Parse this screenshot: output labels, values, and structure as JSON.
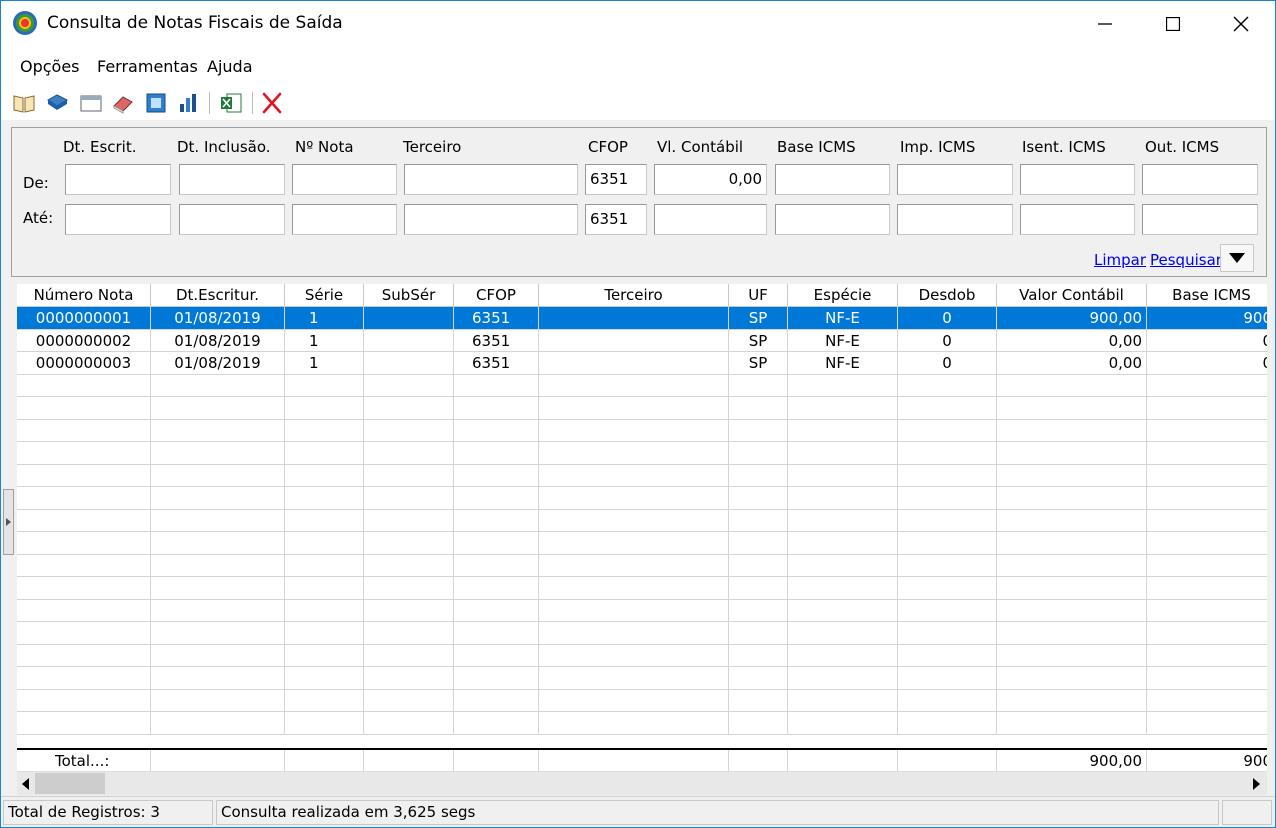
{
  "window": {
    "title": "Consulta de Notas Fiscais de Saída"
  },
  "menu": {
    "items": [
      "Opções",
      "Ferramentas",
      "Ajuda"
    ]
  },
  "toolbar": {
    "icons": [
      "open-book-icon",
      "book-icon",
      "window-icon",
      "eraser-icon",
      "screen-icon",
      "chart-icon",
      "excel-icon",
      "close-red-icon"
    ]
  },
  "filters": {
    "row_labels": {
      "from": "De:",
      "to": "Até:"
    },
    "fields": [
      {
        "label": "Dt. Escrit.",
        "from": "",
        "to": ""
      },
      {
        "label": "Dt. Inclusão.",
        "from": "",
        "to": ""
      },
      {
        "label": "Nº Nota",
        "from": "",
        "to": ""
      },
      {
        "label": "Terceiro",
        "from": "",
        "to": ""
      },
      {
        "label": "CFOP",
        "from": "6351",
        "to": "6351"
      },
      {
        "label": "Vl. Contábil",
        "from": "0,00",
        "to": ""
      },
      {
        "label": "Base ICMS",
        "from": "",
        "to": ""
      },
      {
        "label": "Imp. ICMS",
        "from": "",
        "to": ""
      },
      {
        "label": "Isent. ICMS",
        "from": "",
        "to": ""
      },
      {
        "label": "Out. ICMS",
        "from": "",
        "to": ""
      }
    ],
    "clear_label": "Limpar",
    "search_label": "Pesquisar"
  },
  "grid": {
    "columns": [
      "Número Nota",
      "Dt.Escritur.",
      "Série",
      "SubSér",
      "CFOP",
      "Terceiro",
      "UF",
      "Espécie",
      "Desdob",
      "Valor Contábil",
      "Base ICMS"
    ],
    "rows": [
      [
        "0000000001",
        "01/08/2019",
        "1",
        "",
        "6351",
        "",
        "SP",
        "NF-E",
        "0",
        "900,00",
        "900"
      ],
      [
        "0000000002",
        "01/08/2019",
        "1",
        "",
        "6351",
        "",
        "SP",
        "NF-E",
        "0",
        "0,00",
        "0"
      ],
      [
        "0000000003",
        "01/08/2019",
        "1",
        "",
        "6351",
        "",
        "SP",
        "NF-E",
        "0",
        "0,00",
        "0"
      ]
    ],
    "total_label": "Total...:",
    "total_valor": "900,00",
    "total_base": "900"
  },
  "status": {
    "records": "Total de Registros: 3",
    "message": "Consulta realizada em 3,625 segs"
  },
  "colors": {
    "selection": "#0078d7",
    "link": "#0000ee",
    "close_x": "#e81123"
  }
}
